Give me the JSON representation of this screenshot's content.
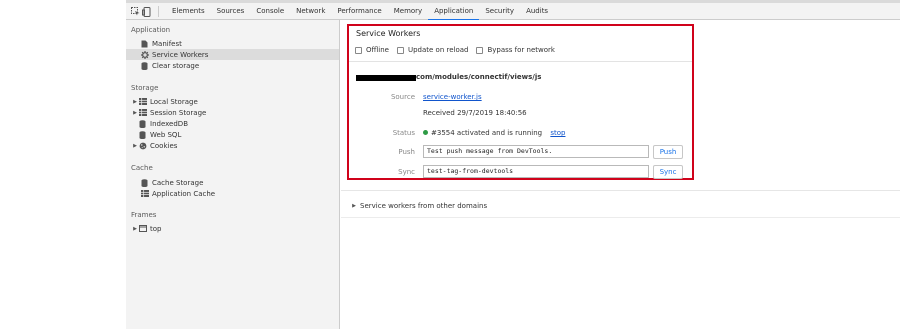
{
  "toolbar": {
    "inspect_icon": "element-picker-icon",
    "device_icon": "device-toolbar-icon",
    "tabs": [
      "Elements",
      "Sources",
      "Console",
      "Network",
      "Performance",
      "Memory",
      "Application",
      "Security",
      "Audits"
    ],
    "active_tab": "Application",
    "accent_color": "#1a73e8"
  },
  "sidebar": {
    "application_header": "Application",
    "application_items": [
      {
        "label": "Manifest",
        "icon": "document-icon"
      },
      {
        "label": "Service Workers",
        "icon": "gear-icon",
        "selected": true
      },
      {
        "label": "Clear storage",
        "icon": "database-icon"
      }
    ],
    "storage_header": "Storage",
    "storage_items": [
      {
        "label": "Local Storage",
        "icon": "grid-icon",
        "expandable": true
      },
      {
        "label": "Session Storage",
        "icon": "grid-icon",
        "expandable": true
      },
      {
        "label": "IndexedDB",
        "icon": "database-icon"
      },
      {
        "label": "Web SQL",
        "icon": "database-icon"
      },
      {
        "label": "Cookies",
        "icon": "cookie-icon",
        "expandable": true
      }
    ],
    "cache_header": "Cache",
    "cache_items": [
      {
        "label": "Cache Storage",
        "icon": "database-icon"
      },
      {
        "label": "Application Cache",
        "icon": "grid-icon"
      }
    ],
    "frames_header": "Frames",
    "frames_items": [
      {
        "label": "top",
        "icon": "frame-icon",
        "expandable": true
      }
    ]
  },
  "service_workers": {
    "title": "Service Workers",
    "options": [
      "Offline",
      "Update on reload",
      "Bypass for network"
    ],
    "scope_url": "com/modules/connectif/views/js",
    "source_label": "Source",
    "source_link": "service-worker.js",
    "received": "Received 29/7/2019 18:40:56",
    "status_label": "Status",
    "status_text": "#3554 activated and is running",
    "status_color": "#2e9b45",
    "stop_link": "stop",
    "push_label": "Push",
    "push_value": "Test push message from DevTools.",
    "push_button": "Push",
    "sync_label": "Sync",
    "sync_value": "test-tag-from-devtools",
    "sync_button": "Sync",
    "highlight_color": "#d0021b"
  },
  "other_domains": {
    "label": "Service workers from other domains"
  }
}
